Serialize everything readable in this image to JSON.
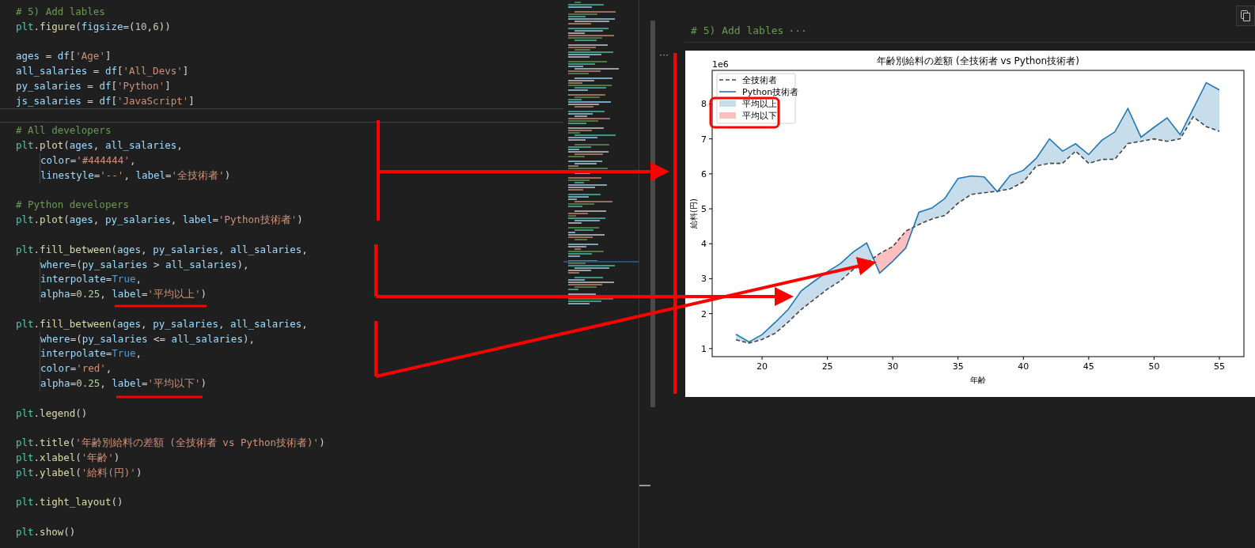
{
  "editor": {
    "lines": [
      {
        "kind": "code",
        "current": false,
        "indented": false,
        "tokens": [
          {
            "kind": "cm",
            "text": "# 5) Add lables"
          }
        ]
      },
      {
        "kind": "code",
        "current": false,
        "indented": false,
        "tokens": [
          {
            "kind": "mod",
            "text": "plt"
          },
          {
            "kind": "fn",
            "text": ".figure"
          },
          {
            "kind": "op",
            "text": "("
          },
          {
            "kind": "var",
            "text": "figsize"
          },
          {
            "kind": "op",
            "text": "=("
          },
          {
            "kind": "num",
            "text": "10"
          },
          {
            "kind": "op",
            "text": ","
          },
          {
            "kind": "num",
            "text": "6"
          },
          {
            "kind": "op",
            "text": "))"
          }
        ]
      },
      {
        "kind": "blank",
        "current": false
      },
      {
        "kind": "code",
        "current": false,
        "indented": false,
        "tokens": [
          {
            "kind": "var",
            "text": "ages"
          },
          {
            "kind": "op",
            "text": " = "
          },
          {
            "kind": "var",
            "text": "df"
          },
          {
            "kind": "op",
            "text": "["
          },
          {
            "kind": "str",
            "text": "'Age'"
          },
          {
            "kind": "op",
            "text": "]"
          }
        ]
      },
      {
        "kind": "code",
        "current": false,
        "indented": false,
        "tokens": [
          {
            "kind": "var",
            "text": "all_salaries"
          },
          {
            "kind": "op",
            "text": " = "
          },
          {
            "kind": "var",
            "text": "df"
          },
          {
            "kind": "op",
            "text": "["
          },
          {
            "kind": "str",
            "text": "'All_Devs'"
          },
          {
            "kind": "op",
            "text": "]"
          }
        ]
      },
      {
        "kind": "code",
        "current": false,
        "indented": false,
        "tokens": [
          {
            "kind": "var",
            "text": "py_salaries"
          },
          {
            "kind": "op",
            "text": " = "
          },
          {
            "kind": "var",
            "text": "df"
          },
          {
            "kind": "op",
            "text": "["
          },
          {
            "kind": "str",
            "text": "'Python'"
          },
          {
            "kind": "op",
            "text": "]"
          }
        ]
      },
      {
        "kind": "code",
        "current": false,
        "indented": false,
        "tokens": [
          {
            "kind": "var",
            "text": "js_salaries"
          },
          {
            "kind": "op",
            "text": " = "
          },
          {
            "kind": "var",
            "text": "df"
          },
          {
            "kind": "op",
            "text": "["
          },
          {
            "kind": "str",
            "text": "'JavaScript'"
          },
          {
            "kind": "op",
            "text": "]"
          }
        ]
      },
      {
        "kind": "blank",
        "current": true
      },
      {
        "kind": "code",
        "current": false,
        "indented": false,
        "tokens": [
          {
            "kind": "cm",
            "text": "# All developers"
          }
        ]
      },
      {
        "kind": "code",
        "current": false,
        "indented": false,
        "tokens": [
          {
            "kind": "mod",
            "text": "plt"
          },
          {
            "kind": "fn",
            "text": ".plot"
          },
          {
            "kind": "op",
            "text": "("
          },
          {
            "kind": "var",
            "text": "ages"
          },
          {
            "kind": "op",
            "text": ", "
          },
          {
            "kind": "var",
            "text": "all_salaries"
          },
          {
            "kind": "op",
            "text": ","
          }
        ]
      },
      {
        "kind": "code",
        "current": false,
        "indented": true,
        "tokens": [
          {
            "kind": "var",
            "text": "color"
          },
          {
            "kind": "op",
            "text": "="
          },
          {
            "kind": "str",
            "text": "'#444444'"
          },
          {
            "kind": "op",
            "text": ","
          }
        ]
      },
      {
        "kind": "code",
        "current": false,
        "indented": true,
        "tokens": [
          {
            "kind": "var",
            "text": "linestyle"
          },
          {
            "kind": "op",
            "text": "="
          },
          {
            "kind": "str",
            "text": "'--'"
          },
          {
            "kind": "op",
            "text": ", "
          },
          {
            "kind": "var",
            "text": "label"
          },
          {
            "kind": "op",
            "text": "="
          },
          {
            "kind": "str",
            "text": "'全技術者'"
          },
          {
            "kind": "op",
            "text": ")"
          }
        ]
      },
      {
        "kind": "blank",
        "current": false
      },
      {
        "kind": "code",
        "current": false,
        "indented": false,
        "tokens": [
          {
            "kind": "cm",
            "text": "# Python developers"
          }
        ]
      },
      {
        "kind": "code",
        "current": false,
        "indented": false,
        "tokens": [
          {
            "kind": "mod",
            "text": "plt"
          },
          {
            "kind": "fn",
            "text": ".plot"
          },
          {
            "kind": "op",
            "text": "("
          },
          {
            "kind": "var",
            "text": "ages"
          },
          {
            "kind": "op",
            "text": ", "
          },
          {
            "kind": "var",
            "text": "py_salaries"
          },
          {
            "kind": "op",
            "text": ", "
          },
          {
            "kind": "var",
            "text": "label"
          },
          {
            "kind": "op",
            "text": "="
          },
          {
            "kind": "str",
            "text": "'Python技術者'"
          },
          {
            "kind": "op",
            "text": ")"
          }
        ]
      },
      {
        "kind": "blank",
        "current": false
      },
      {
        "kind": "code",
        "current": false,
        "indented": false,
        "tokens": [
          {
            "kind": "mod",
            "text": "plt"
          },
          {
            "kind": "fn",
            "text": ".fill_between"
          },
          {
            "kind": "op",
            "text": "("
          },
          {
            "kind": "var",
            "text": "ages"
          },
          {
            "kind": "op",
            "text": ", "
          },
          {
            "kind": "var",
            "text": "py_salaries"
          },
          {
            "kind": "op",
            "text": ", "
          },
          {
            "kind": "var",
            "text": "all_salaries"
          },
          {
            "kind": "op",
            "text": ","
          }
        ]
      },
      {
        "kind": "code",
        "current": false,
        "indented": true,
        "tokens": [
          {
            "kind": "var",
            "text": "where"
          },
          {
            "kind": "op",
            "text": "=("
          },
          {
            "kind": "var",
            "text": "py_salaries"
          },
          {
            "kind": "op",
            "text": " > "
          },
          {
            "kind": "var",
            "text": "all_salaries"
          },
          {
            "kind": "op",
            "text": "),"
          }
        ]
      },
      {
        "kind": "code",
        "current": false,
        "indented": true,
        "tokens": [
          {
            "kind": "var",
            "text": "interpolate"
          },
          {
            "kind": "op",
            "text": "="
          },
          {
            "kind": "kw",
            "text": "True"
          },
          {
            "kind": "op",
            "text": ","
          }
        ]
      },
      {
        "kind": "code",
        "current": false,
        "indented": true,
        "tokens": [
          {
            "kind": "var",
            "text": "alpha"
          },
          {
            "kind": "op",
            "text": "="
          },
          {
            "kind": "num",
            "text": "0.25"
          },
          {
            "kind": "op",
            "text": ", "
          },
          {
            "kind": "var",
            "text": "label"
          },
          {
            "kind": "op",
            "text": "="
          },
          {
            "kind": "str",
            "text": "'平均以上'"
          },
          {
            "kind": "op",
            "text": ")"
          }
        ]
      },
      {
        "kind": "blank",
        "current": false
      },
      {
        "kind": "code",
        "current": false,
        "indented": false,
        "tokens": [
          {
            "kind": "mod",
            "text": "plt"
          },
          {
            "kind": "fn",
            "text": ".fill_between"
          },
          {
            "kind": "op",
            "text": "("
          },
          {
            "kind": "var",
            "text": "ages"
          },
          {
            "kind": "op",
            "text": ", "
          },
          {
            "kind": "var",
            "text": "py_salaries"
          },
          {
            "kind": "op",
            "text": ", "
          },
          {
            "kind": "var",
            "text": "all_salaries"
          },
          {
            "kind": "op",
            "text": ","
          }
        ]
      },
      {
        "kind": "code",
        "current": false,
        "indented": true,
        "tokens": [
          {
            "kind": "var",
            "text": "where"
          },
          {
            "kind": "op",
            "text": "=("
          },
          {
            "kind": "var",
            "text": "py_salaries"
          },
          {
            "kind": "op",
            "text": " <= "
          },
          {
            "kind": "var",
            "text": "all_salaries"
          },
          {
            "kind": "op",
            "text": "),"
          }
        ]
      },
      {
        "kind": "code",
        "current": false,
        "indented": true,
        "tokens": [
          {
            "kind": "var",
            "text": "interpolate"
          },
          {
            "kind": "op",
            "text": "="
          },
          {
            "kind": "kw",
            "text": "True"
          },
          {
            "kind": "op",
            "text": ","
          }
        ]
      },
      {
        "kind": "code",
        "current": false,
        "indented": true,
        "tokens": [
          {
            "kind": "var",
            "text": "color"
          },
          {
            "kind": "op",
            "text": "="
          },
          {
            "kind": "str",
            "text": "'red'"
          },
          {
            "kind": "op",
            "text": ","
          }
        ]
      },
      {
        "kind": "code",
        "current": false,
        "indented": true,
        "tokens": [
          {
            "kind": "var",
            "text": "alpha"
          },
          {
            "kind": "op",
            "text": "="
          },
          {
            "kind": "num",
            "text": "0.25"
          },
          {
            "kind": "op",
            "text": ", "
          },
          {
            "kind": "var",
            "text": "label"
          },
          {
            "kind": "op",
            "text": "="
          },
          {
            "kind": "str",
            "text": "'平均以下'"
          },
          {
            "kind": "op",
            "text": ")"
          }
        ]
      },
      {
        "kind": "blank",
        "current": false
      },
      {
        "kind": "code",
        "current": false,
        "indented": false,
        "tokens": [
          {
            "kind": "mod",
            "text": "plt"
          },
          {
            "kind": "fn",
            "text": ".legend"
          },
          {
            "kind": "op",
            "text": "()"
          }
        ]
      },
      {
        "kind": "blank",
        "current": false
      },
      {
        "kind": "code",
        "current": false,
        "indented": false,
        "tokens": [
          {
            "kind": "mod",
            "text": "plt"
          },
          {
            "kind": "fn",
            "text": ".title"
          },
          {
            "kind": "op",
            "text": "("
          },
          {
            "kind": "str",
            "text": "'年齢別給料の差額 (全技術者 vs Python技術者)'"
          },
          {
            "kind": "op",
            "text": ")"
          }
        ]
      },
      {
        "kind": "code",
        "current": false,
        "indented": false,
        "tokens": [
          {
            "kind": "mod",
            "text": "plt"
          },
          {
            "kind": "fn",
            "text": ".xlabel"
          },
          {
            "kind": "op",
            "text": "("
          },
          {
            "kind": "str",
            "text": "'年齢'"
          },
          {
            "kind": "op",
            "text": ")"
          }
        ]
      },
      {
        "kind": "code",
        "current": false,
        "indented": false,
        "tokens": [
          {
            "kind": "mod",
            "text": "plt"
          },
          {
            "kind": "fn",
            "text": ".ylabel"
          },
          {
            "kind": "op",
            "text": "("
          },
          {
            "kind": "str",
            "text": "'給料(円)'"
          },
          {
            "kind": "op",
            "text": ")"
          }
        ]
      },
      {
        "kind": "blank",
        "current": false
      },
      {
        "kind": "code",
        "current": false,
        "indented": false,
        "tokens": [
          {
            "kind": "mod",
            "text": "plt"
          },
          {
            "kind": "fn",
            "text": ".tight_layout"
          },
          {
            "kind": "op",
            "text": "()"
          }
        ]
      },
      {
        "kind": "blank",
        "current": false
      },
      {
        "kind": "code",
        "current": false,
        "indented": false,
        "tokens": [
          {
            "kind": "mod",
            "text": "plt"
          },
          {
            "kind": "fn",
            "text": ".show"
          },
          {
            "kind": "op",
            "text": "()"
          }
        ]
      }
    ]
  },
  "output": {
    "cell_header": "# 5) Add lables",
    "collapsed_indicator": "···",
    "more_indicator": "···",
    "axis_offset_label": "1e6",
    "fills": [
      {
        "label": "平均以上",
        "color": "#c7ddec",
        "kind": "above"
      },
      {
        "label": "平均以下",
        "color": "#ffbfbf",
        "kind": "below"
      }
    ],
    "chart_data": {
      "type": "line",
      "title": "年齢別給料の差額 (全技術者 vs Python技術者)",
      "xlabel": "年齢",
      "ylabel": "給料(円)",
      "legend": "upper left",
      "x": [
        18,
        19,
        20,
        21,
        22,
        23,
        24,
        25,
        26,
        27,
        28,
        29,
        30,
        31,
        32,
        33,
        34,
        35,
        36,
        37,
        38,
        39,
        40,
        41,
        42,
        43,
        44,
        45,
        46,
        47,
        48,
        49,
        50,
        51,
        52,
        53,
        54,
        55
      ],
      "series": [
        {
          "name": "全技術者",
          "color": "#444444",
          "line_style": "dashed",
          "values": [
            1.25,
            1.16,
            1.26,
            1.44,
            1.76,
            2.12,
            2.41,
            2.7,
            2.94,
            3.27,
            3.45,
            3.72,
            3.92,
            4.36,
            4.55,
            4.71,
            4.81,
            5.16,
            5.41,
            5.46,
            5.5,
            5.57,
            5.77,
            6.23,
            6.3,
            6.3,
            6.65,
            6.3,
            6.41,
            6.42,
            6.87,
            6.93,
            7.0,
            6.93,
            7.0,
            7.63,
            7.35,
            7.22
          ]
        },
        {
          "name": "Python技術者",
          "color": "#1f77b4",
          "line_style": "solid",
          "values": [
            1.41,
            1.19,
            1.4,
            1.75,
            2.12,
            2.65,
            2.93,
            3.2,
            3.43,
            3.77,
            4.02,
            3.16,
            3.5,
            3.88,
            4.9,
            5.02,
            5.3,
            5.87,
            5.94,
            5.91,
            5.49,
            5.96,
            6.1,
            6.45,
            7.0,
            6.65,
            6.86,
            6.55,
            6.96,
            7.2,
            7.87,
            7.05,
            7.33,
            7.6,
            7.12,
            7.86,
            8.61,
            8.4
          ]
        }
      ],
      "xlim": [
        16.18,
        56.88
      ],
      "ylim": [
        0.77,
        8.96
      ],
      "xticks": [
        20,
        25,
        30,
        35,
        40,
        45,
        50,
        55
      ],
      "yticks": [
        1,
        2,
        3,
        4,
        5,
        6,
        7,
        8
      ]
    }
  }
}
